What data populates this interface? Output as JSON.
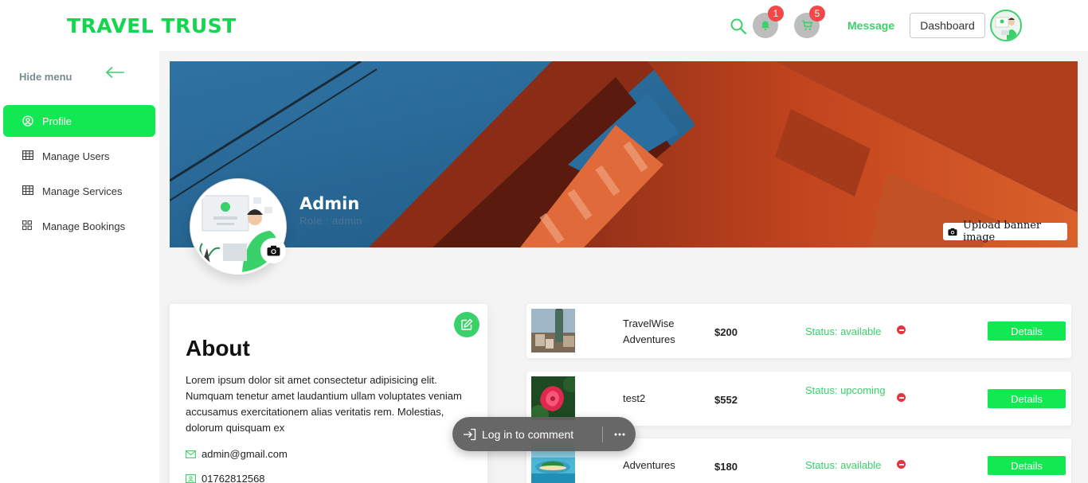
{
  "header": {
    "logo": "TRAVEL TRUST",
    "notifications_count": "1",
    "cart_count": "5",
    "message_label": "Message",
    "dashboard_label": "Dashboard"
  },
  "sidebar": {
    "hide_label": "Hide menu",
    "items": [
      {
        "label": "Profile",
        "icon": "user-circle-icon",
        "active": true
      },
      {
        "label": "Manage Users",
        "icon": "table-icon"
      },
      {
        "label": "Manage Services",
        "icon": "table-icon"
      },
      {
        "label": "Manage Bookings",
        "icon": "grid-icon"
      }
    ]
  },
  "profile": {
    "name": "Admin",
    "role": "Role : admin",
    "upload_banner_label": "Upload banner image"
  },
  "about": {
    "title": "About",
    "text": "Lorem ipsum dolor sit amet consectetur adipisicing elit. Numquam tenetur amet laudantium ullam voluptates veniam accusamus exercitationem alias veritatis rem. Molestias, dolorum quisquam ex",
    "email": "admin@gmail.com",
    "phone": "01762812568"
  },
  "services": [
    {
      "name": "TravelWise Adventures",
      "price": "$200",
      "status": "Status: available",
      "details_label": "Details"
    },
    {
      "name": "test2",
      "price": "$552",
      "status": "Status: upcoming",
      "details_label": "Details"
    },
    {
      "name": "Adventures",
      "price": "$180",
      "status": "Status: available",
      "details_label": "Details"
    }
  ],
  "comment_pill": {
    "login_label": "Log in to comment"
  },
  "colors": {
    "brand_green": "#12e852",
    "accent_green": "#3ad06a",
    "badge_red": "#f44747",
    "remove_red": "#e5343d"
  }
}
